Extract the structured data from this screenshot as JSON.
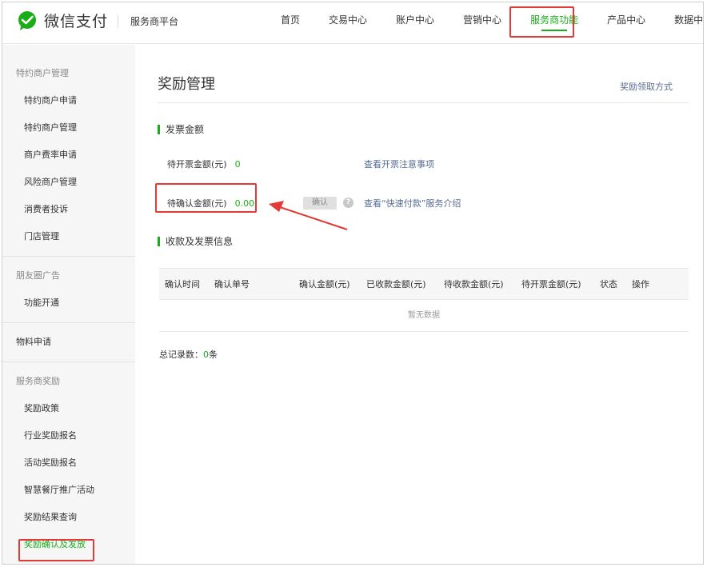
{
  "header": {
    "logo_text": "微信支付",
    "platform": "服务商平台",
    "nav": [
      {
        "label": "首页"
      },
      {
        "label": "交易中心"
      },
      {
        "label": "账户中心"
      },
      {
        "label": "营销中心"
      },
      {
        "label": "服务商功能"
      },
      {
        "label": "产品中心"
      },
      {
        "label": "数据中心"
      }
    ]
  },
  "sidebar": {
    "group1": {
      "title": "特约商户管理",
      "items": [
        "特约商户申请",
        "特约商户管理",
        "商户费率申请",
        "风险商户管理",
        "消费者投诉",
        "门店管理"
      ]
    },
    "group2": {
      "title": "朋友圈广告",
      "items": [
        "功能开通"
      ]
    },
    "top_item": "物料申请",
    "group3": {
      "title": "服务商奖励",
      "items": [
        "奖励政策",
        "行业奖励报名",
        "活动奖励报名",
        "智慧餐厅推广活动",
        "奖励结果查询",
        "奖励确认及发放"
      ]
    }
  },
  "main": {
    "title": "奖励管理",
    "title_link": "奖励领取方式",
    "section1": {
      "title": "发票金额",
      "pending_invoice_label": "待开票金额(元)",
      "pending_invoice_value": "0",
      "invoice_notes_link": "查看开票注意事项",
      "pending_confirm_label": "待确认金额(元)",
      "pending_confirm_value": "0.00",
      "confirm_button": "确认",
      "help_icon": "?",
      "quick_pay_link": "查看“快速付款”服务介绍"
    },
    "section2": {
      "title": "收款及发票信息",
      "columns": [
        "确认时间",
        "确认单号",
        "确认金额(元)",
        "已收款金额(元)",
        "待收款金额(元)",
        "待开票金额(元)",
        "状态",
        "操作"
      ],
      "empty_text": "暂无数据",
      "total_label": "总记录数：",
      "total_count": "0",
      "total_unit": "条"
    }
  },
  "colors": {
    "accent": "#1aad19",
    "link": "#576b95",
    "annotation": "#e53935"
  }
}
